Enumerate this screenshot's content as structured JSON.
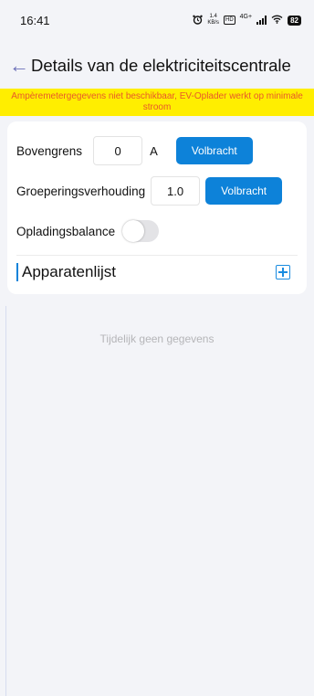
{
  "status": {
    "time": "16:41",
    "speed_value": "1.4",
    "speed_unit": "KB/s",
    "hd": "HD",
    "network": "4G+",
    "battery": "82"
  },
  "header": {
    "title": "Details van de elektriciteitscentrale"
  },
  "warning": "Ampèremetergegevens niet beschikbaar, EV-Oplader werkt op minimale stroom",
  "settings": {
    "upper_limit": {
      "label": "Bovengrens",
      "value": "0",
      "unit": "A",
      "button": "Volbracht"
    },
    "group_ratio": {
      "label": "Groeperingsverhouding",
      "value": "1.0",
      "button": "Volbracht"
    },
    "balance": {
      "label": "Opladingsbalance",
      "enabled": false
    }
  },
  "devices": {
    "title": "Apparatenlijst",
    "empty_text": "Tijdelijk geen gegevens"
  },
  "colors": {
    "accent": "#0d82d9",
    "warning_bg": "#ffee00",
    "warning_text": "#e8592a"
  }
}
